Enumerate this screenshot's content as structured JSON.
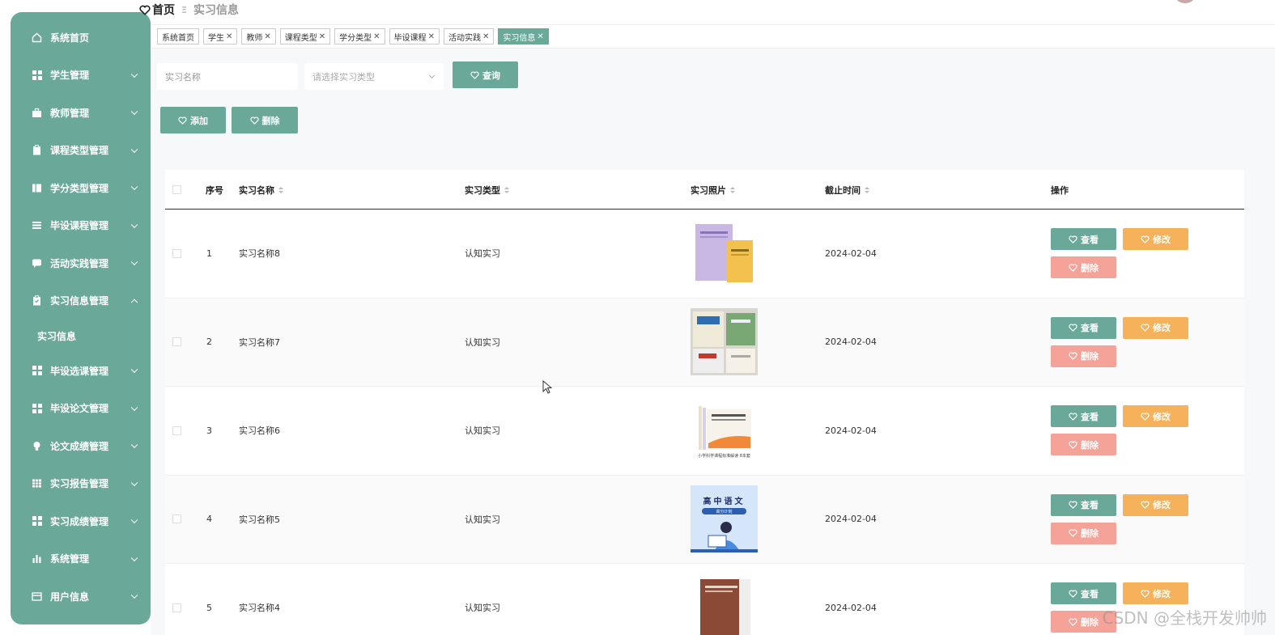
{
  "sidebar": {
    "items": [
      {
        "label": "系统首页",
        "icon": "home-icon"
      },
      {
        "label": "学生管理",
        "icon": "grid-icon"
      },
      {
        "label": "教师管理",
        "icon": "briefcase-icon"
      },
      {
        "label": "课程类型管理",
        "icon": "clipboard-icon"
      },
      {
        "label": "学分类型管理",
        "icon": "map-icon"
      },
      {
        "label": "毕设课程管理",
        "icon": "list-icon"
      },
      {
        "label": "活动实践管理",
        "icon": "chat-icon"
      },
      {
        "label": "实习信息管理",
        "icon": "clipboard-icon"
      },
      {
        "label": "毕设选课管理",
        "icon": "grid-icon"
      },
      {
        "label": "毕设论文管理",
        "icon": "grid-icon"
      },
      {
        "label": "论文成绩管理",
        "icon": "bulb-icon"
      },
      {
        "label": "实习报告管理",
        "icon": "table-icon"
      },
      {
        "label": "实习成绩管理",
        "icon": "grid-icon"
      },
      {
        "label": "系统管理",
        "icon": "bar-chart-icon"
      },
      {
        "label": "用户信息",
        "icon": "card-icon"
      }
    ],
    "sub_item": "实习信息"
  },
  "breadcrumb": {
    "home": "首页",
    "current": "实习信息"
  },
  "tags": [
    {
      "label": "系统首页",
      "closable": false
    },
    {
      "label": "学生",
      "closable": true
    },
    {
      "label": "教师",
      "closable": true
    },
    {
      "label": "课程类型",
      "closable": true
    },
    {
      "label": "学分类型",
      "closable": true
    },
    {
      "label": "毕设课程",
      "closable": true
    },
    {
      "label": "活动实践",
      "closable": true
    },
    {
      "label": "实习信息",
      "closable": true,
      "active": true
    }
  ],
  "search": {
    "name_placeholder": "实习名称",
    "type_placeholder": "请选择实习类型",
    "query_label": "查询"
  },
  "actions": {
    "add_label": "添加",
    "delete_label": "删除"
  },
  "table": {
    "headers": {
      "index": "序号",
      "name": "实习名称",
      "type": "实习类型",
      "photo": "实习照片",
      "deadline": "截止时间",
      "ops": "操作"
    },
    "ops_labels": {
      "view": "查看",
      "edit": "修改",
      "delete": "删除"
    },
    "rows": [
      {
        "index": "1",
        "name": "实习名称8",
        "type": "认知实习",
        "deadline": "2024-02-04",
        "photo": "purple-yellow-books"
      },
      {
        "index": "2",
        "name": "实习名称7",
        "type": "认知实习",
        "deadline": "2024-02-04",
        "photo": "study-books"
      },
      {
        "index": "3",
        "name": "实习名称6",
        "type": "认知实习",
        "deadline": "2024-02-04",
        "photo": "book-set",
        "photo_caption": "小学科学课程标准解读 8本套"
      },
      {
        "index": "4",
        "name": "实习名称5",
        "type": "认知实习",
        "deadline": "2024-02-04",
        "photo": "chinese-book-cover",
        "photo_title": "高中语文",
        "photo_subtitle": "高分计划"
      },
      {
        "index": "5",
        "name": "实习名称4",
        "type": "认知实习",
        "deadline": "2024-02-04",
        "photo": "brown-book"
      }
    ]
  },
  "watermark": "CSDN @全栈开发帅帅",
  "colors": {
    "primary": "#6aa899",
    "edit": "#f5b25a",
    "danger": "#f5a399"
  }
}
